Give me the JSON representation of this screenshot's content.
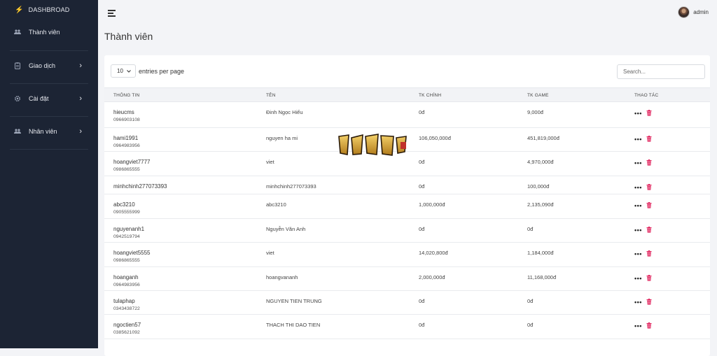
{
  "sidebar": {
    "brand": "DASHBROAD",
    "items": [
      {
        "label": "Thành viên",
        "icon": "users-icon"
      },
      {
        "label": "Giao dịch",
        "icon": "clipboard-icon"
      },
      {
        "label": "Cài đặt",
        "icon": "gear-icon"
      },
      {
        "label": "Nhân viên",
        "icon": "users-icon"
      }
    ]
  },
  "header": {
    "username": "admin"
  },
  "page": {
    "title": "Thành viên"
  },
  "table_controls": {
    "page_length": "10",
    "entries_label": "entries per page",
    "search_placeholder": "Search..."
  },
  "table": {
    "columns": [
      "THÔNG TIN",
      "TÊN",
      "TK CHÍNH",
      "TK GAME",
      "THAO TÁC"
    ],
    "rows": [
      {
        "username": "hieucms",
        "phone": "0966903108",
        "name": "Đinh Ngọc Hiếu",
        "main": "0đ",
        "game": "9,000đ"
      },
      {
        "username": "hami1991",
        "phone": "0964983956",
        "name": "nguyen ha mi",
        "main": "106,050,000đ",
        "game": "451,819,000đ"
      },
      {
        "username": "hoangviet7777",
        "phone": "0986865555",
        "name": "viet",
        "main": "0đ",
        "game": "4,970,000đ"
      },
      {
        "username": "minhchinh277073393",
        "phone": "",
        "name": "minhchinh277073393",
        "main": "0đ",
        "game": "100,000đ"
      },
      {
        "username": "abc3210",
        "phone": "0905555999",
        "name": "abc3210",
        "main": "1,000,000đ",
        "game": "2,135,090đ"
      },
      {
        "username": "nguyenanh1",
        "phone": "0942519794",
        "name": "Nguyễn Văn Anh",
        "main": "0đ",
        "game": "0đ"
      },
      {
        "username": "hoangviet5555",
        "phone": "0986865555",
        "name": "viet",
        "main": "14,020,800đ",
        "game": "1,184,000đ"
      },
      {
        "username": "hoanganh",
        "phone": "0964983956",
        "name": "hoangvananh",
        "main": "2,000,000đ",
        "game": "11,168,000đ"
      },
      {
        "username": "tulaphap",
        "phone": "0343438722",
        "name": "NGUYEN TIEN TRUNG",
        "main": "0đ",
        "game": "0đ"
      },
      {
        "username": "ngoctien57",
        "phone": "0385621092",
        "name": "THACH THI DAO TIEN",
        "main": "0đ",
        "game": "0đ"
      }
    ]
  },
  "colors": {
    "sidebar_bg": "#1c2434",
    "accent_bolt": "#f5b800",
    "delete_red": "#e0245e"
  }
}
